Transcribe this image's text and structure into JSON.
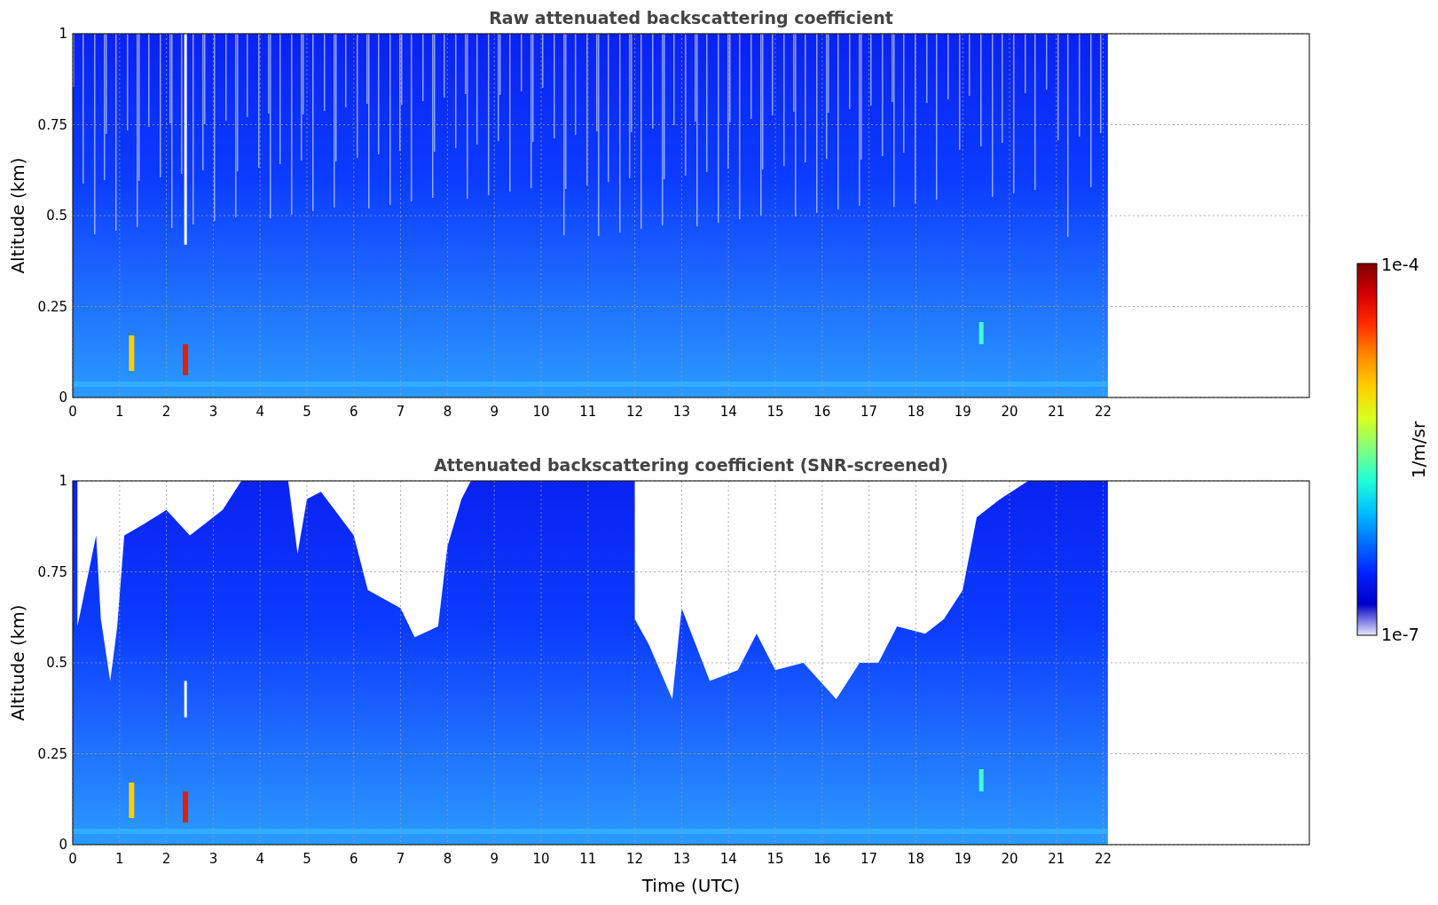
{
  "figure": {
    "panels": [
      {
        "kind": "raw",
        "title": "Raw attenuated backscattering coefficient",
        "ylabel": "Altitude (km)",
        "yticks": [
          "1",
          "0.75",
          "0.5",
          "0.25",
          "0"
        ],
        "xticks": [
          "0",
          "1",
          "2",
          "3",
          "4",
          "5",
          "6",
          "7",
          "8",
          "9",
          "10",
          "11",
          "12",
          "13",
          "14",
          "15",
          "16",
          "17",
          "18",
          "19",
          "20",
          "21",
          "22"
        ]
      },
      {
        "kind": "screened",
        "title": "Attenuated backscattering coefficient (SNR-screened)",
        "ylabel": "Altitude (km)",
        "yticks": [
          "1",
          "0.75",
          "0.5",
          "0.25",
          "0"
        ],
        "xticks": [
          "0",
          "1",
          "2",
          "3",
          "4",
          "5",
          "6",
          "7",
          "8",
          "9",
          "10",
          "11",
          "12",
          "13",
          "14",
          "15",
          "16",
          "17",
          "18",
          "19",
          "20",
          "21",
          "22"
        ]
      }
    ],
    "xlabel": "Time (UTC)",
    "colorbar": {
      "max_label": "1e-4",
      "min_label": "1e-7",
      "label": "1/m/sr"
    }
  }
}
